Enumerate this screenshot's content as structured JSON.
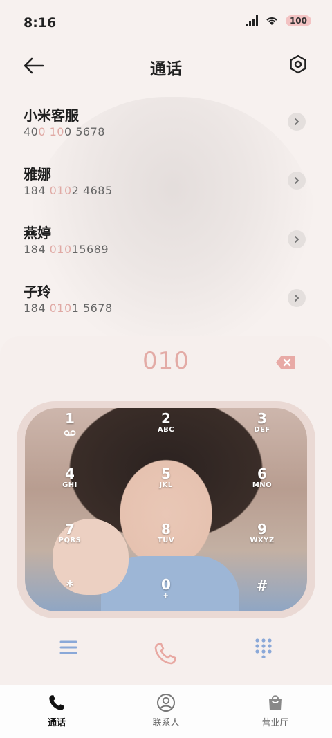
{
  "status": {
    "time": "8:16",
    "battery": "100"
  },
  "header": {
    "title": "通话"
  },
  "contacts": [
    {
      "name": "小米客服",
      "number_parts": [
        "40",
        "0 10",
        "0 5678"
      ]
    },
    {
      "name": "雅娜",
      "number_parts": [
        "184 ",
        "010",
        "2 4685"
      ]
    },
    {
      "name": "燕婷",
      "number_parts": [
        "184 ",
        "010",
        "15689"
      ]
    },
    {
      "name": "子玲",
      "number_parts": [
        "184 ",
        "010",
        "1 5678"
      ]
    }
  ],
  "dialer": {
    "input": "010",
    "keys": [
      {
        "digit": "1",
        "letters": ""
      },
      {
        "digit": "2",
        "letters": "ABC"
      },
      {
        "digit": "3",
        "letters": "DEF"
      },
      {
        "digit": "4",
        "letters": "GHI"
      },
      {
        "digit": "5",
        "letters": "JKL"
      },
      {
        "digit": "6",
        "letters": "MNO"
      },
      {
        "digit": "7",
        "letters": "PQRS"
      },
      {
        "digit": "8",
        "letters": "TUV"
      },
      {
        "digit": "9",
        "letters": "WXYZ"
      },
      {
        "digit": "*",
        "letters": ""
      },
      {
        "digit": "0",
        "letters": "+"
      },
      {
        "digit": "#",
        "letters": ""
      }
    ]
  },
  "bottom_nav": [
    {
      "label": "通话",
      "icon": "phone-icon",
      "active": true
    },
    {
      "label": "联系人",
      "icon": "contacts-icon",
      "active": false
    },
    {
      "label": "营业厅",
      "icon": "shopping-bag-icon",
      "active": false
    }
  ],
  "colors": {
    "accent": "#e3aba6",
    "blue_icon": "#8aa8d8"
  }
}
